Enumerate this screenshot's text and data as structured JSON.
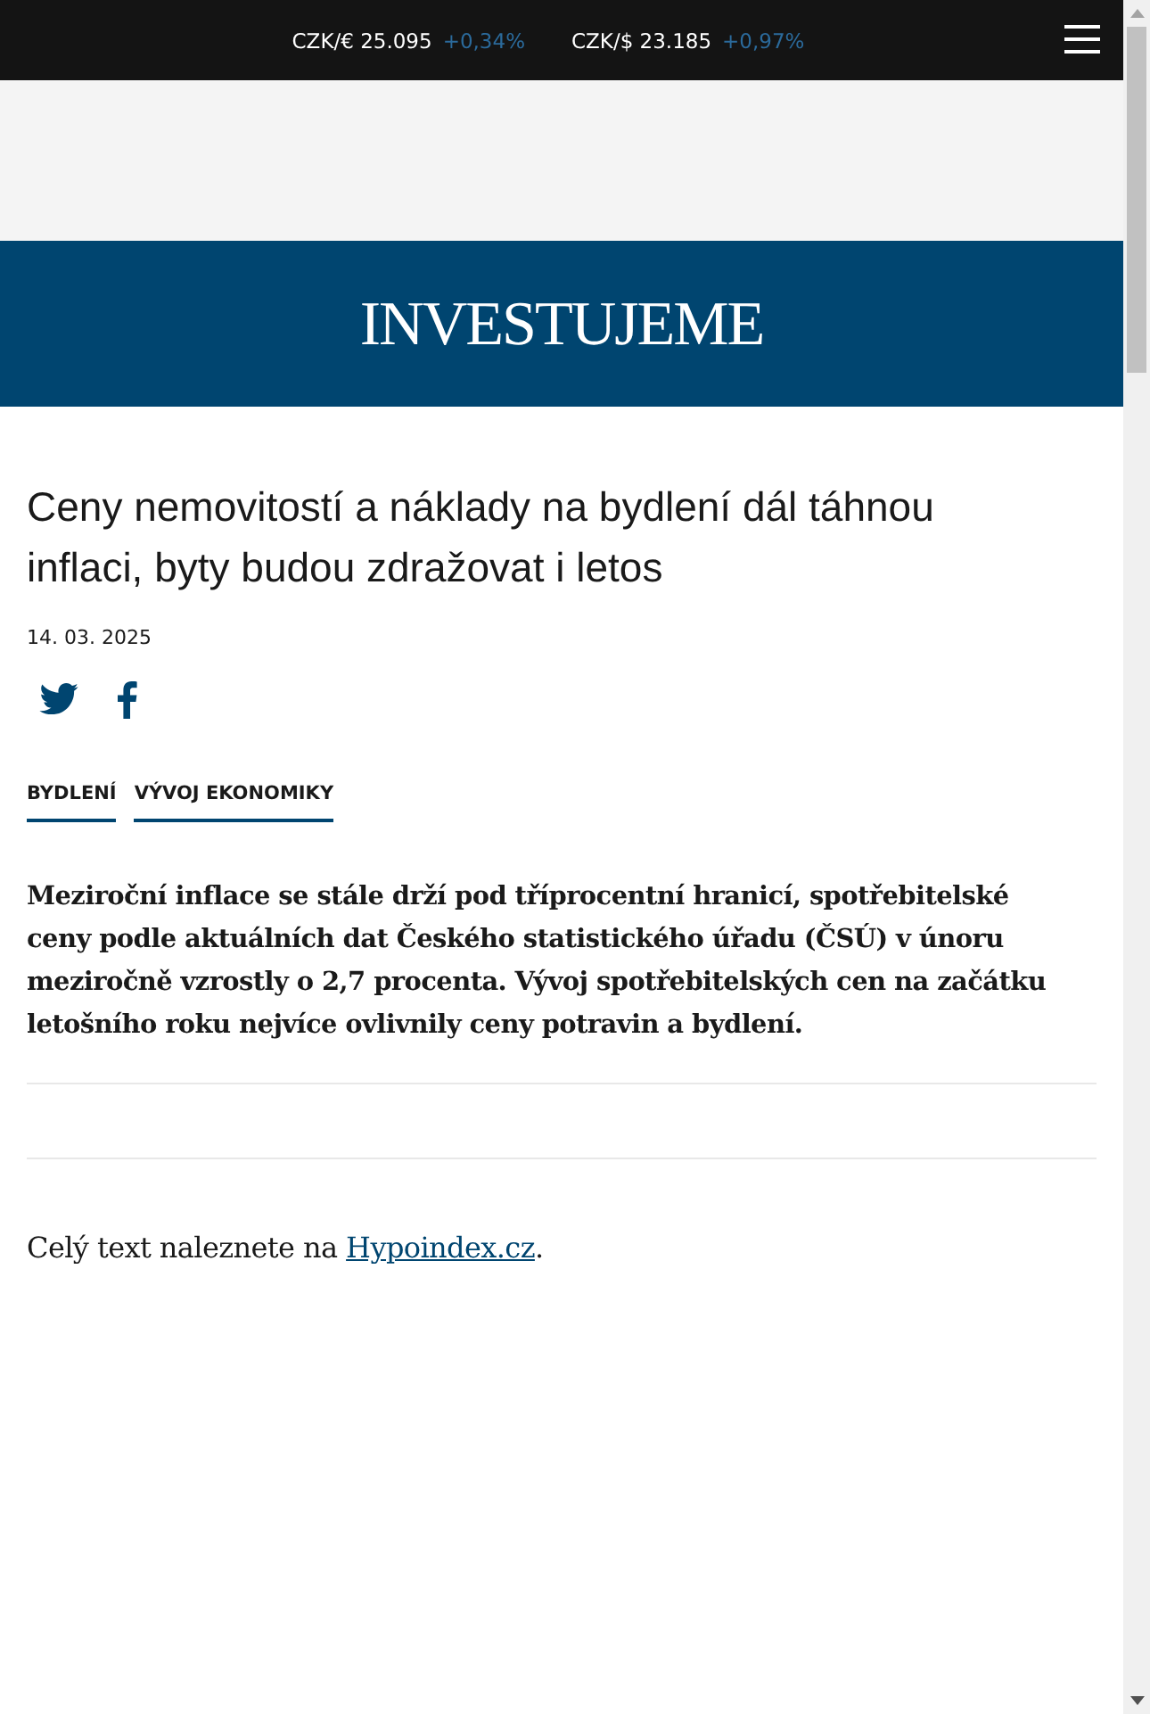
{
  "ticker": [
    {
      "pair": "CZK/€ 25.095",
      "change": "+0,34%"
    },
    {
      "pair": "CZK/$ 23.185",
      "change": "+0,97%"
    }
  ],
  "logo": "INVESTUJEME",
  "article": {
    "title": "Ceny nemovitostí a náklady na bydlení dál táhnou inflaci, byty budou zdražovat i letos",
    "date": "14. 03. 2025",
    "share": [
      {
        "kind": "twitter"
      },
      {
        "kind": "facebook"
      }
    ],
    "tags": [
      "BYDLENÍ",
      "VÝVOJ EKONOMIKY"
    ],
    "perex": "Meziroční inflace se stále drží pod tříprocentní hranicí, spotřebitelské ceny podle aktuálních dat Českého statistického úřadu (ČSÚ) v únoru meziročně vzrostly o 2,7 procenta. Vývoj spotřebitelských cen na začátku letošního roku nejvíce ovlivnily ceny potravin a bydlení.",
    "source": {
      "prefix": "Celý text naleznete na ",
      "link": "Hypoindex.cz",
      "suffix": "."
    }
  }
}
